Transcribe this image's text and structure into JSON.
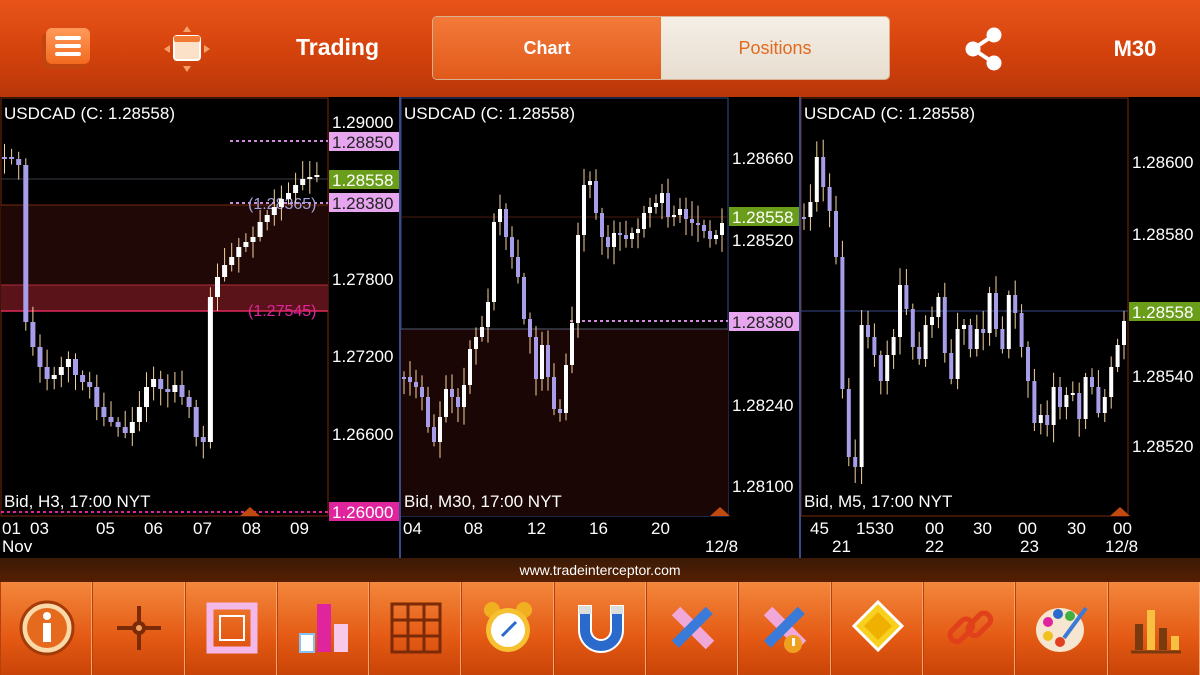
{
  "header": {
    "title": "Trading",
    "tabs": [
      {
        "label": "Chart",
        "active": true
      },
      {
        "label": "Positions",
        "active": false
      }
    ],
    "timeframe": "M30",
    "icons": [
      "menu-icon",
      "window-icon",
      "share-icon"
    ]
  },
  "colors": {
    "bar_bg": "#d4420c",
    "bull_candle": "#ffffff",
    "bear_candle": "#a79de8",
    "current_price_label": "#6a9e1a",
    "pending_label": "#e7a5f0",
    "alert_label": "#e0249e"
  },
  "charts": [
    {
      "symbol_label": "USDCAD (C: 1.28558)",
      "footer_label": "Bid, H3, 17:00 NYT",
      "y_ticks": [
        "1.29000",
        "1.27800",
        "1.27200",
        "1.26600"
      ],
      "price_tags": [
        {
          "value": "1.28850",
          "type": "pending"
        },
        {
          "value": "1.28558",
          "type": "current"
        },
        {
          "value": "1.28380",
          "type": "pending"
        },
        {
          "value": "1.26000",
          "type": "alert"
        }
      ],
      "inline_labels": [
        {
          "text": "(1.28365)",
          "type": "pending"
        },
        {
          "text": "(1.27545)",
          "type": "alert"
        }
      ],
      "x_ticks": [
        "01",
        "03",
        "05",
        "06",
        "07",
        "08",
        "09"
      ],
      "x_sub": [
        "Nov"
      ]
    },
    {
      "symbol_label": "USDCAD (C: 1.28558)",
      "footer_label": "Bid, M30, 17:00 NYT",
      "y_ticks": [
        "1.28660",
        "1.28520",
        "1.28240",
        "1.28100"
      ],
      "price_tags": [
        {
          "value": "1.28558",
          "type": "current"
        },
        {
          "value": "1.28380",
          "type": "pending"
        }
      ],
      "inline_labels": [],
      "x_ticks": [
        "04",
        "08",
        "12",
        "16",
        "20"
      ],
      "x_sub": [
        "12/8"
      ]
    },
    {
      "symbol_label": "USDCAD (C: 1.28558)",
      "footer_label": "Bid, M5, 17:00 NYT",
      "y_ticks": [
        "1.28600",
        "1.28580",
        "1.28540",
        "1.28520"
      ],
      "price_tags": [
        {
          "value": "1.28558",
          "type": "current"
        }
      ],
      "inline_labels": [],
      "x_ticks": [
        "45",
        "1530",
        "00",
        "30",
        "00",
        "30",
        "00"
      ],
      "x_sub": [
        "21",
        "22",
        "23",
        "12/8"
      ]
    }
  ],
  "footer": {
    "url": "www.tradeinterceptor.com"
  },
  "toolbar": {
    "items": [
      "info-icon",
      "crosshair-icon",
      "ruler-frame-icon",
      "bar-chart-icon",
      "grid-icon",
      "alarm-clock-icon",
      "magnet-icon",
      "drawing-tools-icon",
      "drawing-tools-alert-icon",
      "color-fill-icon",
      "chain-link-icon",
      "palette-icon",
      "indicators-icon"
    ]
  }
}
